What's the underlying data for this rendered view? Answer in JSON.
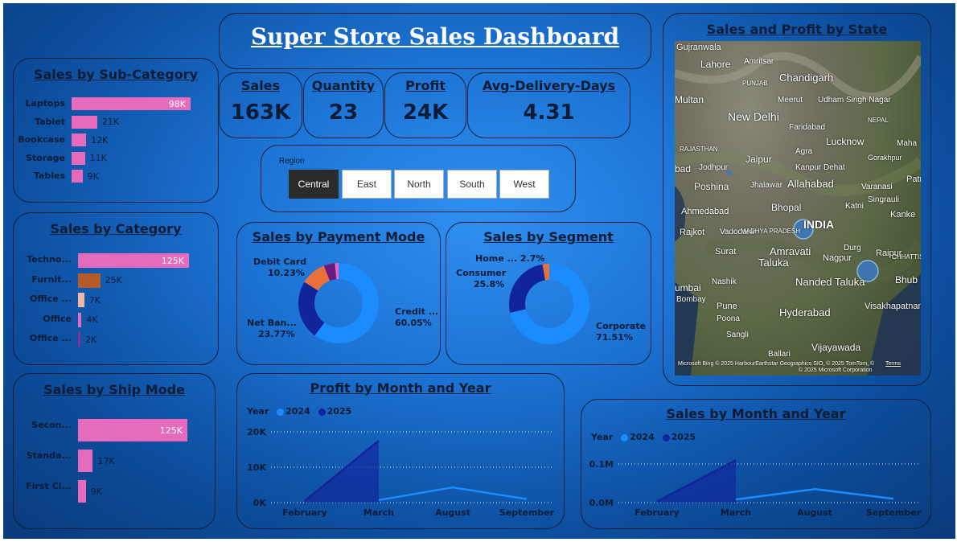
{
  "title": "Super Store Sales Dashboard",
  "kpis": [
    {
      "label": "Sales",
      "value": "163K"
    },
    {
      "label": "Quantity",
      "value": "23"
    },
    {
      "label": "Profit",
      "value": "24K"
    },
    {
      "label": "Avg-Delivery-Days",
      "value": "4.31"
    }
  ],
  "region_slicer": {
    "label": "Region",
    "options": [
      "Central",
      "East",
      "North",
      "South",
      "West"
    ],
    "selected": "Central"
  },
  "colors": {
    "pink": "#e76bbd",
    "brown": "#b55a2a",
    "light_pink": "#f2b8a6",
    "purple": "#8a2e9e",
    "blue_2024": "#1a8cff",
    "navy_2025": "#12249a",
    "orange": "#e8703a"
  },
  "sub_category": {
    "title": "Sales by Sub-Category",
    "items": [
      {
        "label": "Laptops",
        "value_label": "98K",
        "value": 98,
        "color": "#e76bbd"
      },
      {
        "label": "Tablet",
        "value_label": "21K",
        "value": 21,
        "color": "#e76bbd"
      },
      {
        "label": "Bookcase",
        "value_label": "12K",
        "value": 12,
        "color": "#e76bbd"
      },
      {
        "label": "Storage",
        "value_label": "11K",
        "value": 11,
        "color": "#e76bbd"
      },
      {
        "label": "Tables",
        "value_label": "9K",
        "value": 9,
        "color": "#e76bbd"
      }
    ]
  },
  "category": {
    "title": "Sales by Category",
    "items": [
      {
        "label": "Techno...",
        "value_label": "125K",
        "value": 125,
        "color": "#e76bbd"
      },
      {
        "label": "Furnit...",
        "value_label": "25K",
        "value": 25,
        "color": "#b55a2a"
      },
      {
        "label": "Office ...",
        "value_label": "7K",
        "value": 7,
        "color": "#f2b8a6"
      },
      {
        "label": "Office",
        "value_label": "4K",
        "value": 4,
        "color": "#e76bbd"
      },
      {
        "label": "Office ...",
        "value_label": "2K",
        "value": 2,
        "color": "#8a2e9e"
      }
    ]
  },
  "ship_mode": {
    "title": "Sales by Ship Mode",
    "items": [
      {
        "label": "Secon...",
        "value_label": "125K",
        "value": 125,
        "color": "#e76bbd"
      },
      {
        "label": "Standa...",
        "value_label": "17K",
        "value": 17,
        "color": "#e76bbd"
      },
      {
        "label": "First Cl...",
        "value_label": "9K",
        "value": 9,
        "color": "#e76bbd"
      }
    ]
  },
  "payment_mode": {
    "title": "Sales by Payment Mode",
    "slices": [
      {
        "name": "Credit ...",
        "pct_label": "60.05%",
        "value": 60.05,
        "color": "#1a8cff"
      },
      {
        "name": "Net Ban...",
        "pct_label": "23.77%",
        "value": 23.77,
        "color": "#12249a"
      },
      {
        "name": "Debit Card",
        "pct_label": "10.23%",
        "value": 10.23,
        "color": "#e8703a"
      },
      {
        "name": "",
        "pct_label": "",
        "value": 4.5,
        "color": "#6b1a80"
      },
      {
        "name": "",
        "pct_label": "",
        "value": 1.45,
        "color": "#e76bbd"
      }
    ]
  },
  "segment": {
    "title": "Sales by Segment",
    "slices": [
      {
        "name": "Corporate",
        "pct_label": "71.51%",
        "value": 71.51,
        "color": "#1a8cff"
      },
      {
        "name": "Consumer",
        "pct_label": "25.8%",
        "value": 25.8,
        "color": "#12249a"
      },
      {
        "name": "Home ...",
        "pct_label": "2.7%",
        "value": 2.7,
        "color": "#e8703a"
      }
    ]
  },
  "profit_month": {
    "title": "Profit by Month and Year",
    "legend_title": "Year",
    "ylabels": [
      "20K",
      "10K",
      "0K"
    ],
    "chart_data": {
      "type": "area",
      "categories": [
        "February",
        "March",
        "August",
        "September"
      ],
      "ylim": [
        0,
        20000
      ],
      "series": [
        {
          "name": "2024",
          "values": [
            null,
            700,
            4300,
            1000
          ]
        },
        {
          "name": "2025",
          "values": [
            500,
            17500,
            null,
            null
          ]
        }
      ]
    }
  },
  "sales_month": {
    "title": "Sales by Month and Year",
    "legend_title": "Year",
    "ylabels": [
      "0.1M",
      "0.0M"
    ],
    "chart_data": {
      "type": "area",
      "categories": [
        "February",
        "March",
        "August",
        "September"
      ],
      "ylim": [
        0,
        0.125
      ],
      "series": [
        {
          "name": "2024",
          "values": [
            null,
            0.008,
            0.035,
            0.01
          ]
        },
        {
          "name": "2025",
          "values": [
            0.003,
            0.11,
            null,
            null
          ]
        }
      ]
    }
  },
  "map": {
    "title": "Sales and Profit by State",
    "places": [
      "Gujranwala",
      "Lahore",
      "Amritsar",
      "Chandigarh",
      "Multan",
      "PUNJAB",
      "Meerut",
      "Udham Singh Nagar",
      "New Delhi",
      "Faridabad",
      "NEPAL",
      "Lucknow",
      "Maha",
      "RAJASTHAN",
      "Jaipur",
      "Agra",
      "Gorakhpur",
      "bad",
      "Jodhpur",
      "Kanpur Dehat",
      "Patn",
      "Poshina",
      "Jhalawar",
      "Allahabad",
      "Varanasi",
      "Singrauli",
      "Ahmedabad",
      "Bhopal",
      "Katni",
      "Kanke",
      "INDIA",
      "Rajkot",
      "Vadodara",
      "MADHYA PRADESH",
      "Surat",
      "Amravati",
      "Taluka",
      "Nagpur",
      "Durg",
      "Raipur",
      "CHHATTISGARH",
      "umbai",
      "Bombay",
      "Nashik",
      "Nanded Taluka",
      "Bhub",
      "Pune",
      "Poona",
      "Hyderabad",
      "Visakhapatnam",
      "Sangli",
      "Vijayawada",
      "Ballari"
    ],
    "copyright": "© 2025 Microsoft Corporation",
    "attribution": "© 2025 HarbourEarthstar Geographics SIO, © 2025 TomTom, ©",
    "terms": "Terms",
    "provider": "Microsoft Bing"
  }
}
